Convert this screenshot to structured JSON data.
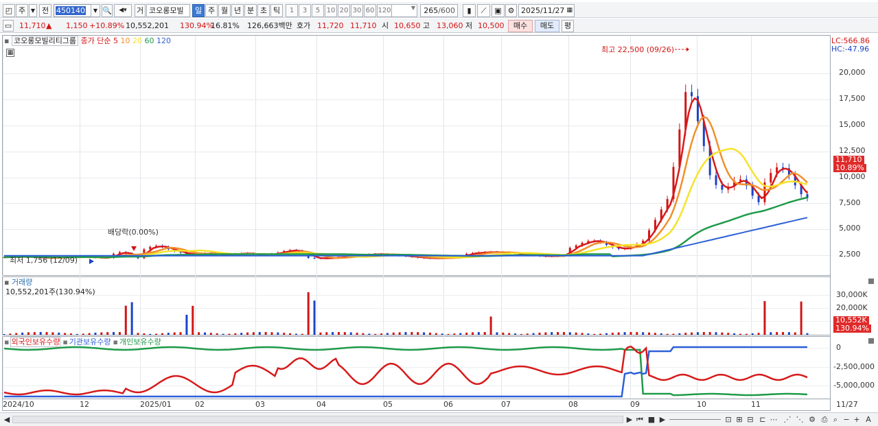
{
  "toolbar": {
    "period_selector": "주",
    "scope_selector": "전",
    "stock_code": "450140",
    "stock_name_prefix": "거",
    "stock_name": "코오롱모빌",
    "period_tabs": [
      "일",
      "주",
      "월",
      "년",
      "분",
      "초",
      "틱"
    ],
    "selected_period": "일",
    "interval_buttons": [
      "1",
      "3",
      "5",
      "10",
      "20",
      "30",
      "60",
      "120"
    ],
    "count_value": "265",
    "count_total": "/600",
    "date": "2025/11/27"
  },
  "quote": {
    "price": "11,710",
    "direction_symbol": "▲",
    "change": "1,150",
    "change_pct": "+10.89%",
    "volume": "10,552,201",
    "volume_ratio": "130.94%",
    "turnover": "16.81%",
    "amount": "126,663백만",
    "ask_label": "호가",
    "ask": "11,720",
    "bid": "11,710",
    "open_label": "시",
    "open": "10,650",
    "high_label": "고",
    "high": "13,060",
    "low_label": "저",
    "low": "10,500",
    "buy_label": "매수",
    "sell_label": "매도",
    "eval_label": "평"
  },
  "price_panel": {
    "stock_title": "코오롱모빌리티그룹",
    "ma_label": "종가 단순",
    "ma_periods": [
      "5",
      "10",
      "20",
      "60",
      "120"
    ],
    "ma_colors": [
      "#d61a1a",
      "#f0902a",
      "#f5e32a",
      "#1e9a49",
      "#2c5fd8"
    ],
    "lc_label": "LC:566.86",
    "hc_label": "HC:-47.96",
    "y_ticks": [
      "20,000",
      "17,500",
      "15,000",
      "12,500",
      "10,000",
      "7,500",
      "5,000",
      "2,500"
    ],
    "current_price_tag": "11,710",
    "current_pct_tag": "10.89%",
    "high_annotation": "최고 22,500 (09/26)",
    "low_annotation": "최저 1,756 (12/09)",
    "dividend_annotation": "배당락(0.00%)"
  },
  "volume_panel": {
    "title": "거래량",
    "value_label": "10,552,201주(130.94%)",
    "y_ticks": [
      "30,000K",
      "20,000K"
    ],
    "current_tag": "10,552K",
    "current_pct_tag": "130.94%"
  },
  "holdings_panel": {
    "legend": [
      "외국인보유수량",
      "기관보유수량",
      "개인보유수량"
    ],
    "legend_colors": [
      "#d61a1a",
      "#2c5fd8",
      "#1e9a49"
    ],
    "y_ticks": [
      "0",
      "-2,500,000",
      "-5,000,000"
    ]
  },
  "x_axis": {
    "labels": [
      "2024/10",
      "12",
      "2025/01",
      "02",
      "03",
      "04",
      "05",
      "06",
      "07",
      "08",
      "09",
      "10",
      "11"
    ],
    "end_label": "11/27"
  },
  "colors": {
    "up": "#d21414",
    "down": "#1b43c8",
    "accent": "#3a7bd5"
  }
}
